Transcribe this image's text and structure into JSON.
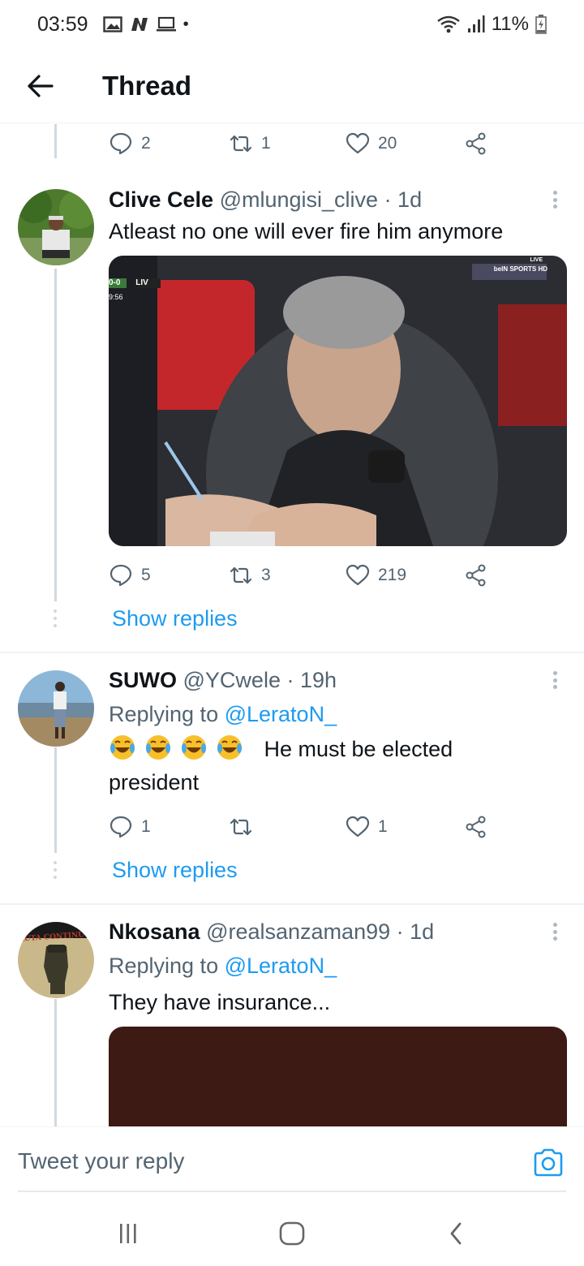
{
  "status_bar": {
    "time": "03:59",
    "dot": "•",
    "battery": "11%"
  },
  "header": {
    "title": "Thread"
  },
  "prev_tweet_actions": {
    "replies": "2",
    "retweets": "1",
    "likes": "20"
  },
  "tweets": [
    {
      "name": "Clive Cele",
      "handle": "@mlungisi_clive · 1d",
      "text": "Atleast no one will ever fire him anymore",
      "media_overlay": {
        "score": "0-0",
        "team": "LIV",
        "clock": "9:56",
        "tag": "beIN SPORTS HD",
        "live": "LIVE"
      },
      "actions": {
        "replies": "5",
        "retweets": "3",
        "likes": "219"
      },
      "show_replies": "Show replies"
    },
    {
      "name": "SUWO",
      "handle": "@YCwele · 19h",
      "replying_prefix": "Replying to",
      "replying_to": "@LeratoN_",
      "text_after_emoji": "He must be elected",
      "text_line2": "president",
      "actions": {
        "replies": "1",
        "retweets": "",
        "likes": "1"
      },
      "show_replies": "Show replies"
    },
    {
      "name": "Nkosana",
      "handle": "@realsanzaman99 · 1d",
      "replying_prefix": "Replying to",
      "replying_to": "@LeratoN_",
      "text": "They have insurance...",
      "avatar_text": "LUTA CONTINU"
    }
  ],
  "composer": {
    "placeholder": "Tweet your reply"
  },
  "colors": {
    "accent": "#1d9bf0",
    "muted": "#536471",
    "media_dark": "#3d1a14"
  },
  "icons": [
    "back-arrow-icon",
    "reply-icon",
    "retweet-icon",
    "like-icon",
    "share-icon",
    "more-icon",
    "camera-icon",
    "recents-icon",
    "home-icon",
    "back-nav-icon"
  ]
}
